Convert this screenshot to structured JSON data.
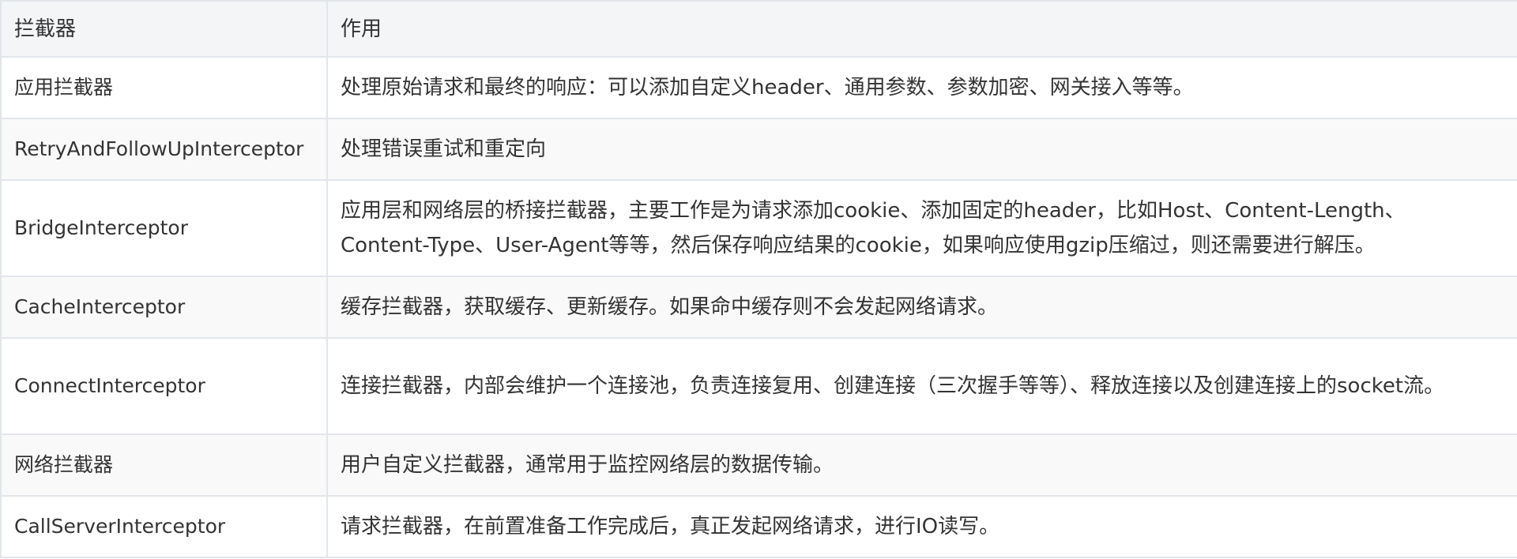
{
  "table": {
    "headers": [
      "拦截器",
      "作用"
    ],
    "rows": [
      {
        "name": "应用拦截器",
        "desc": "处理原始请求和最终的响应：可以添加自定义header、通用参数、参数加密、网关接入等等。"
      },
      {
        "name": "RetryAndFollowUpInterceptor",
        "desc": "处理错误重试和重定向"
      },
      {
        "name": "BridgeInterceptor",
        "desc": "应用层和网络层的桥接拦截器，主要工作是为请求添加cookie、添加固定的header，比如Host、Content-Length、Content-Type、User-Agent等等，然后保存响应结果的cookie，如果响应使用gzip压缩过，则还需要进行解压。"
      },
      {
        "name": "CacheInterceptor",
        "desc": "缓存拦截器，获取缓存、更新缓存。如果命中缓存则不会发起网络请求。"
      },
      {
        "name": "ConnectInterceptor",
        "desc": "连接拦截器，内部会维护一个连接池，负责连接复用、创建连接（三次握手等等）、释放连接以及创建连接上的socket流。"
      },
      {
        "name": "网络拦截器",
        "desc": "用户自定义拦截器，通常用于监控网络层的数据传输。"
      },
      {
        "name": "CallServerInterceptor",
        "desc": "请求拦截器，在前置准备工作完成后，真正发起网络请求，进行IO读写。"
      }
    ]
  }
}
